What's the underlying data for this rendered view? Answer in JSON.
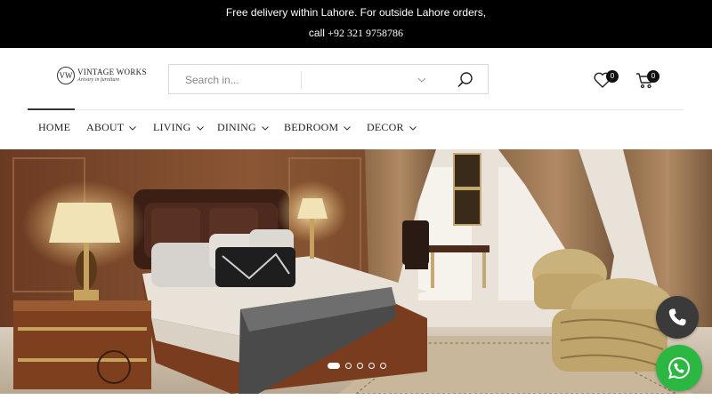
{
  "announcement": {
    "line1": "Free delivery within Lahore. For outside Lahore orders,",
    "line2_prefix": "call",
    "phone": "+92 321 9758786"
  },
  "logo": {
    "mark": "VW",
    "name": "VINTAGE WORKS",
    "tagline": "Artistry in furniture"
  },
  "search": {
    "placeholder": "Search in..."
  },
  "header": {
    "wishlist_count": "0",
    "cart_count": "0"
  },
  "nav": {
    "items": [
      {
        "label": "HOME",
        "has_dropdown": false,
        "active": true
      },
      {
        "label": "ABOUT",
        "has_dropdown": true
      },
      {
        "label": "LIVING",
        "has_dropdown": true
      },
      {
        "label": "DINING",
        "has_dropdown": true
      },
      {
        "label": "BEDROOM",
        "has_dropdown": true
      },
      {
        "label": "DECOR",
        "has_dropdown": true
      }
    ]
  },
  "hero": {
    "slide_count": 5,
    "active_slide": 1,
    "image": "luxury-bedroom-interior"
  },
  "floating": {
    "call_icon": "phone-icon",
    "whatsapp_icon": "whatsapp-icon",
    "whatsapp_color": "#2bb741"
  },
  "colors": {
    "topbar": "#000000",
    "text": "#222222"
  }
}
